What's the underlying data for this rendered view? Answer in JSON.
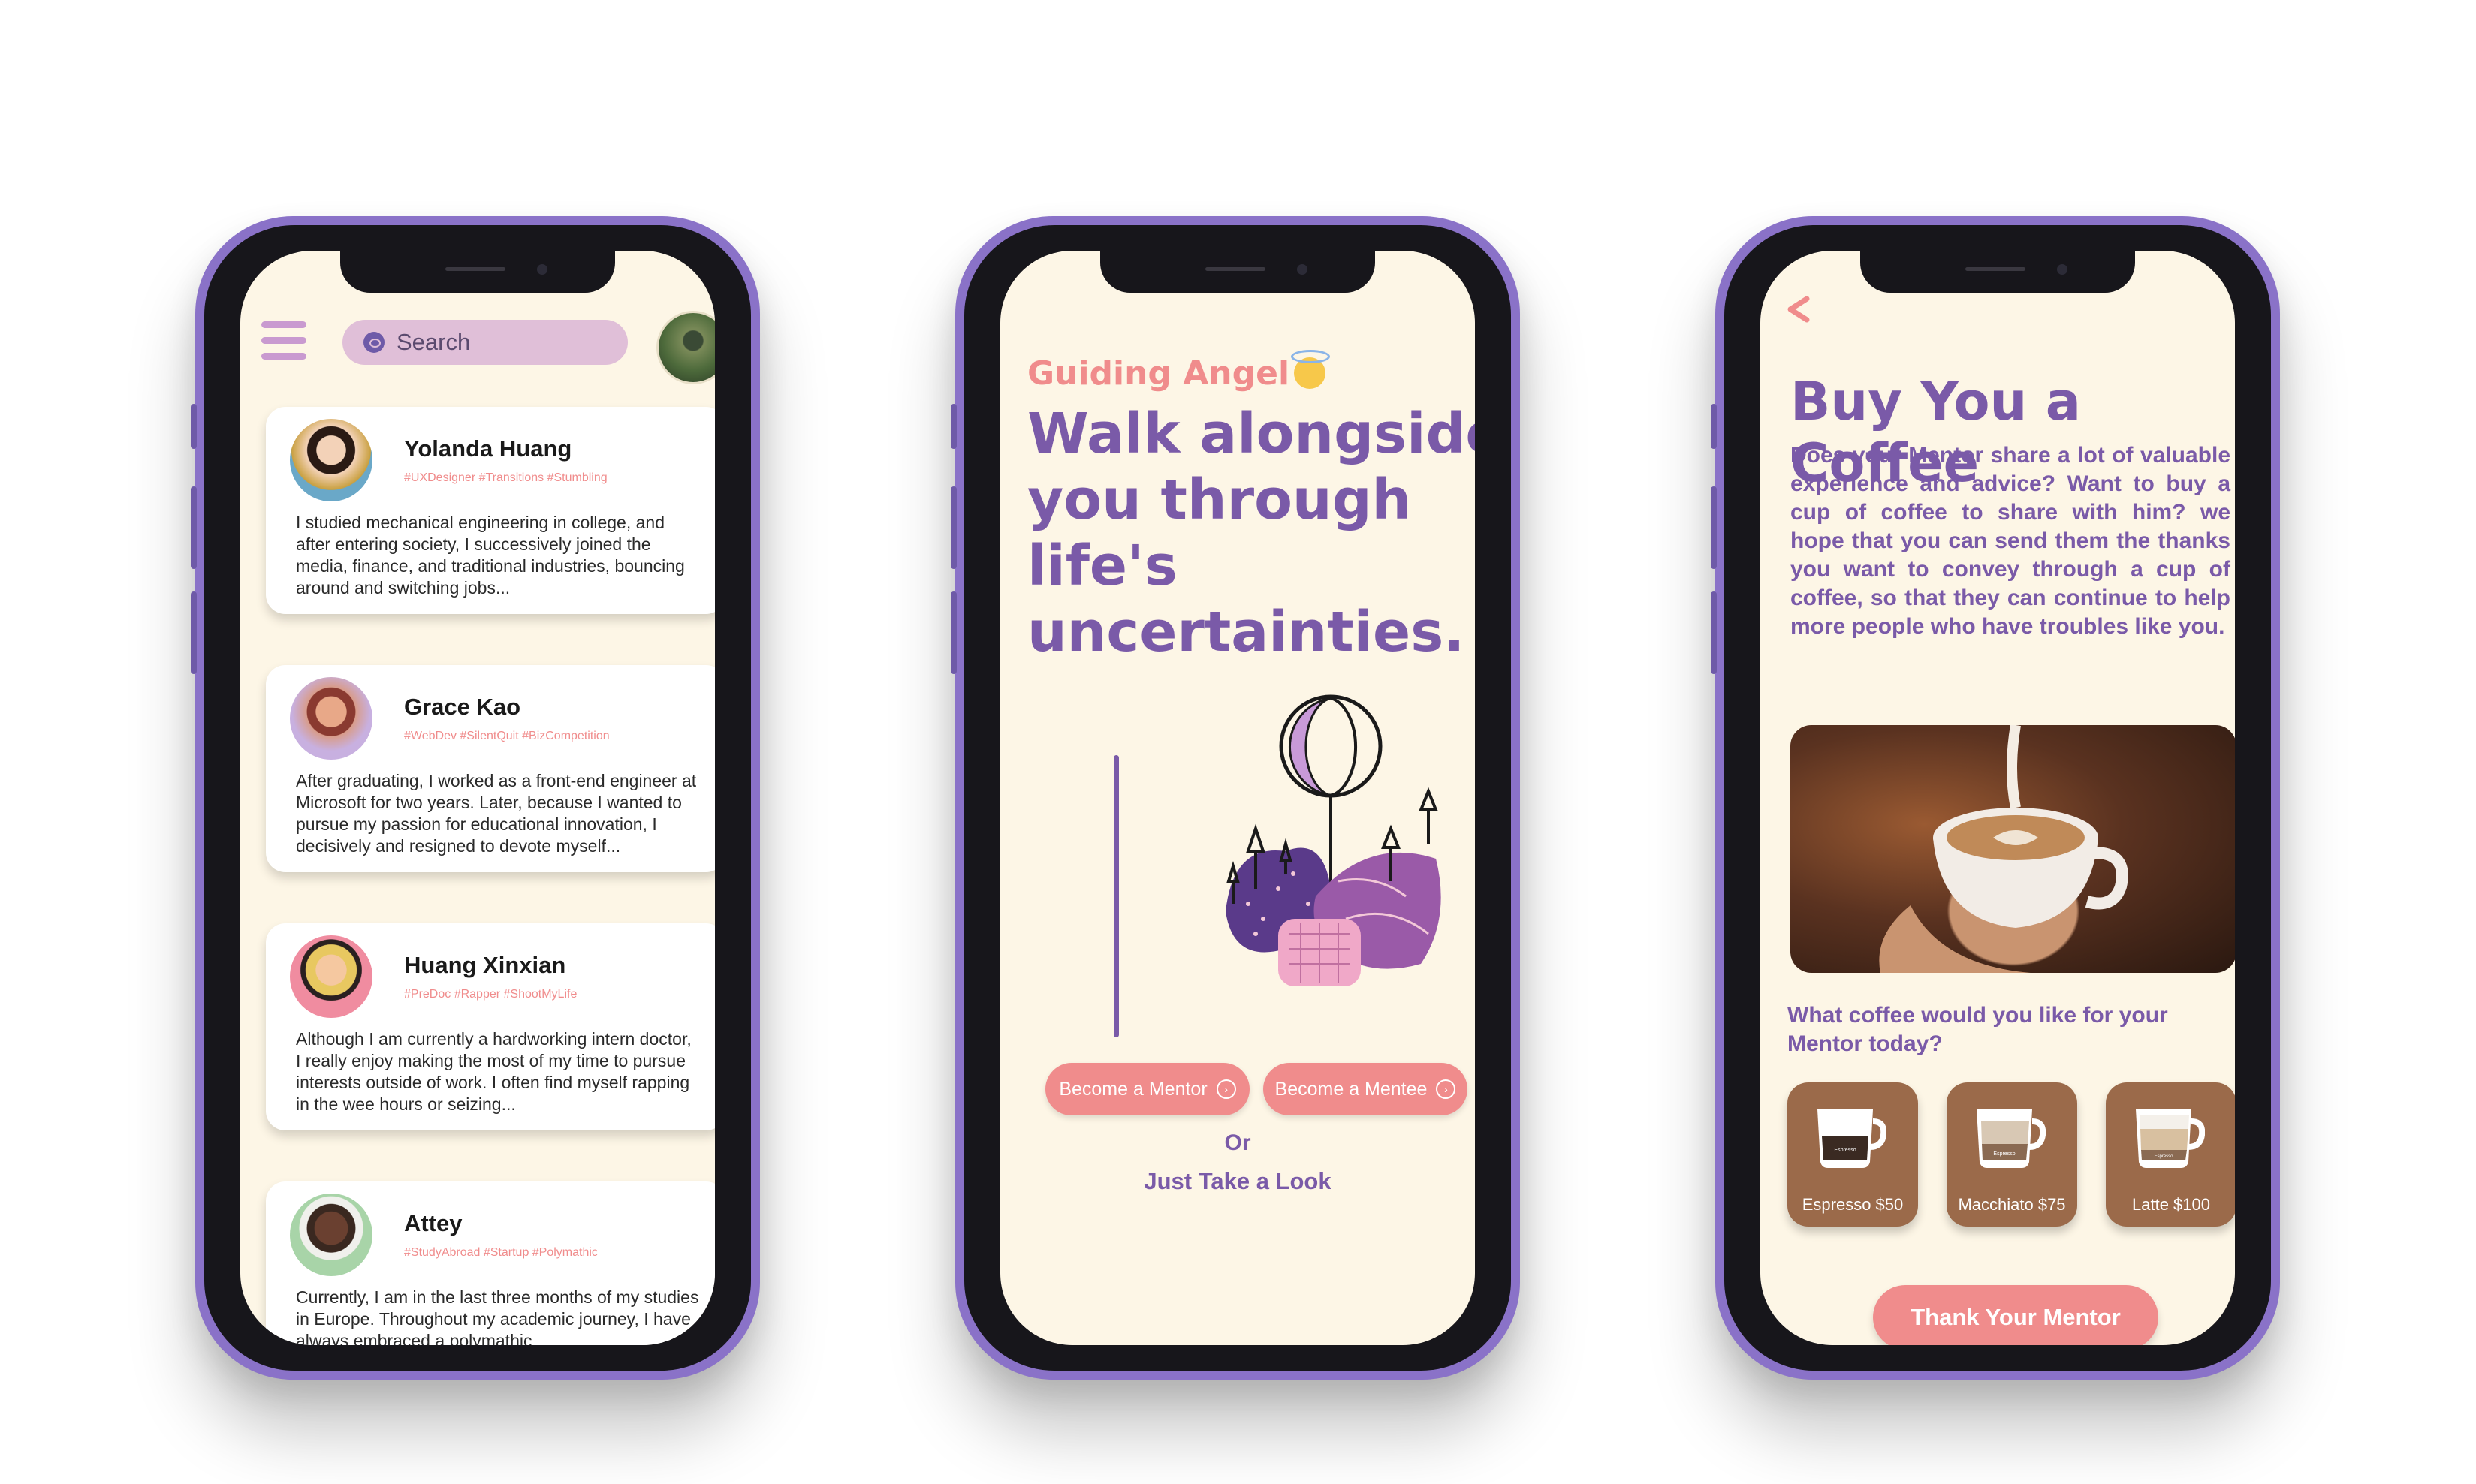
{
  "phone1": {
    "search_placeholder": "Search",
    "profiles": [
      {
        "name": "Yolanda Huang",
        "tags": "#UXDesigner #Transitions #Stumbling",
        "bio": "I studied mechanical engineering in college, and after entering society, I successively joined the media, finance, and traditional industries, bouncing around and switching jobs..."
      },
      {
        "name": "Grace Kao",
        "tags": "#WebDev #SilentQuit #BizCompetition",
        "bio": "After graduating, I worked as a front-end engineer at Microsoft for two years. Later, because I wanted to pursue my passion for educational innovation, I decisively and resigned to devote myself..."
      },
      {
        "name": "Huang Xinxian",
        "tags": "#PreDoc #Rapper #ShootMyLife",
        "bio": "Although I am currently a hardworking intern doctor, I really enjoy making the most of my time to pursue interests outside of work. I often find myself rapping in the wee hours or seizing..."
      },
      {
        "name": "Attey",
        "tags": "#StudyAbroad #Startup #Polymathic",
        "bio": "Currently, I am in the last three months of my studies in Europe. Throughout my academic journey, I have always embraced a polymathic"
      }
    ]
  },
  "phone2": {
    "brand": "Guiding Angel",
    "headline": "Walk alongside you through life's uncertainties.",
    "mentor_button": "Become a Mentor",
    "mentee_button": "Become a Mentee",
    "or": "Or",
    "look": "Just Take a Look"
  },
  "phone3": {
    "title": "Buy You a Coffee",
    "description": "Does your Mentor share a lot of valuable experience and advice? Want to buy a cup of coffee to share with him? we hope that you can send them the thanks you want to convey through a cup of coffee, so that they can continue to help more people who have troubles like you.",
    "question": "What coffee would you like for your Mentor today?",
    "options": [
      {
        "label": "Espresso $50",
        "mug_text": "Espresso"
      },
      {
        "label": "Macchiato $75",
        "mug_text": "Espresso"
      },
      {
        "label": "Latte $100",
        "mug_text": "Espresso"
      }
    ],
    "thank_button": "Thank Your Mentor"
  },
  "colors": {
    "purple": "#7a5aa8",
    "coral": "#f08c8c",
    "cream": "#fdf6e6",
    "coffee": "#9b6a4a"
  }
}
